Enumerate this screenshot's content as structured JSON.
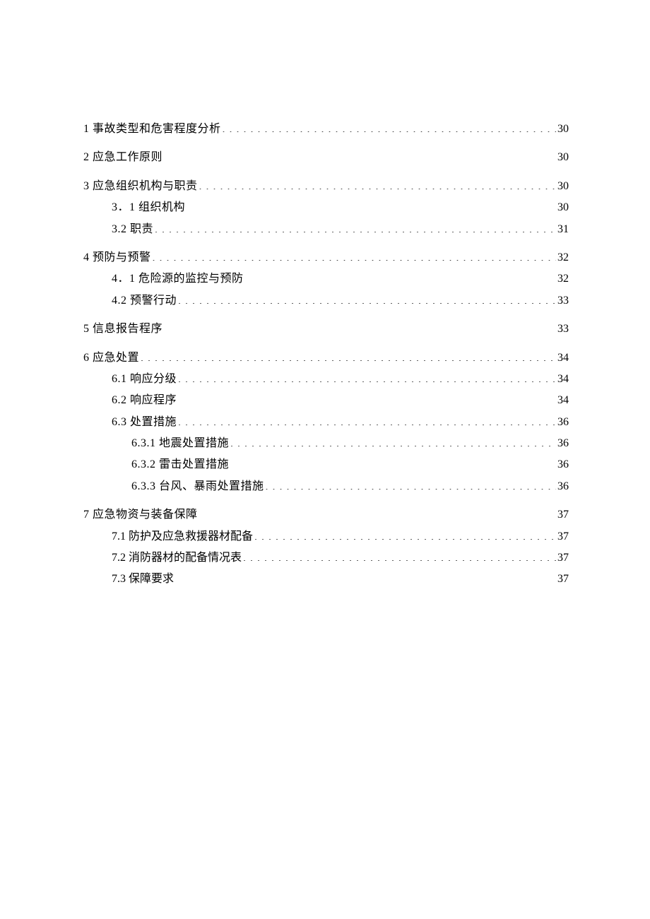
{
  "toc": [
    {
      "type": "level1",
      "label": "1 事故类型和危害程度分析",
      "page": "30",
      "children": []
    },
    {
      "type": "level1",
      "label": "2 应急工作原则",
      "page": "30",
      "children": []
    },
    {
      "type": "level1",
      "label": "3 应急组织机构与职责",
      "page": "30",
      "children": [
        {
          "type": "level2",
          "label": "3．1 组织机构",
          "page": "30"
        },
        {
          "type": "level2",
          "label": "3.2 职责",
          "page": "31"
        }
      ]
    },
    {
      "type": "level1",
      "label": "4 预防与预警",
      "page": "32",
      "children": [
        {
          "type": "level2",
          "label": "4．1 危险源的监控与预防",
          "page": "32"
        },
        {
          "type": "level2",
          "label": "4.2 预警行动",
          "page": "33"
        }
      ]
    },
    {
      "type": "level1",
      "label": "5 信息报告程序",
      "page": "33",
      "children": []
    },
    {
      "type": "level1",
      "label": "6 应急处置",
      "page": "34",
      "children": [
        {
          "type": "level2",
          "label": "6.1 响应分级",
          "page": "34"
        },
        {
          "type": "level2",
          "label": "6.2 响应程序",
          "page": "34"
        },
        {
          "type": "level2",
          "label": "6.3 处置措施",
          "page": "36",
          "children": [
            {
              "type": "level3",
              "label": "6.3.1 地震处置措施",
              "page": "36"
            },
            {
              "type": "level3",
              "label": "6.3.2 雷击处置措施",
              "page": "36"
            },
            {
              "type": "level3",
              "label": "6.3.3 台风、暴雨处置措施",
              "page": "36"
            }
          ]
        }
      ]
    },
    {
      "type": "level1",
      "label": "7 应急物资与装备保障",
      "page": "37",
      "children": [
        {
          "type": "level2",
          "style": "sec7",
          "label": "7.1 防护及应急救援器材配备",
          "page": "37"
        },
        {
          "type": "level2",
          "style": "sec7",
          "label": "7.2 消防器材的配备情况表",
          "page": "37"
        },
        {
          "type": "level2",
          "style": "sec7",
          "label": "7.3 保障要求",
          "page": "37"
        }
      ]
    }
  ]
}
